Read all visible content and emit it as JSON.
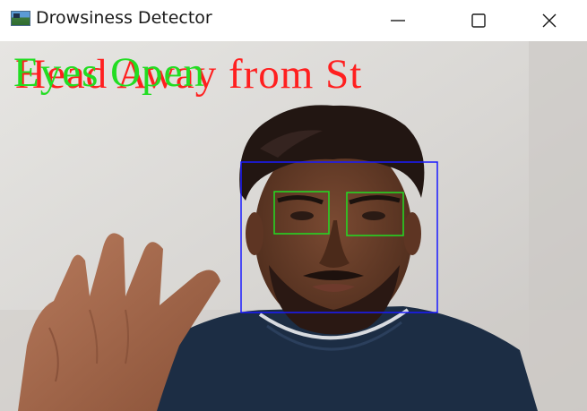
{
  "window": {
    "title": "Drowsiness Detector",
    "controls": {
      "minimize": "minimize-icon",
      "maximize": "maximize-icon",
      "close": "close-icon"
    }
  },
  "video": {
    "overlay_texts": [
      {
        "text": "Head Away from St",
        "color": "#ff1f1f"
      },
      {
        "text": "Eyes Open",
        "color": "#22dd22"
      }
    ],
    "detection_colors": {
      "face_box": "#1a1aff",
      "eye_boxes": "#22dd22"
    }
  }
}
